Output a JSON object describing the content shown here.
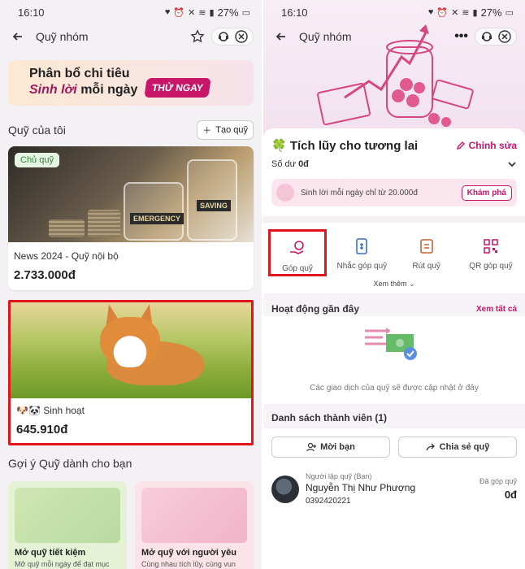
{
  "left": {
    "status": {
      "time": "16:10",
      "battery": "27%"
    },
    "header": {
      "title": "Quỹ nhóm"
    },
    "banner": {
      "line1": "Phân bổ chi tiêu",
      "line2_italic": "Sinh lời",
      "line2_rest": " mỗi ngày",
      "cta": "THỬ NGAY"
    },
    "my_funds": {
      "title": "Quỹ của tôi",
      "create_label": "Tạo quỹ"
    },
    "fund1": {
      "badge": "Chủ quỹ",
      "jar1": "EMERGENCY",
      "jar2": "SAVING",
      "name": "News 2024 - Quỹ nội bộ",
      "amount": "2.733.000đ"
    },
    "fund2": {
      "name": "🐶🐼 Sinh hoạt",
      "amount": "645.910đ"
    },
    "suggest": {
      "title": "Gợi ý Quỹ dành cho bạn",
      "items": [
        {
          "title": "Mở quỹ tiết kiệm",
          "desc": "Mở quỹ mỗi ngày để đạt mục tiêu tiết kiệm và sinh lời."
        },
        {
          "title": "Mở quỹ với người yêu",
          "desc": "Cùng nhau tích lũy, cùng vun đắp cho tương lai."
        }
      ]
    }
  },
  "right": {
    "status": {
      "time": "16:10",
      "battery": "27%"
    },
    "header": {
      "title": "Quỹ nhóm"
    },
    "fund": {
      "title": "🍀 Tích lũy cho tương lai",
      "edit": "Chỉnh sửa",
      "balance_label": "Số dư",
      "balance_value": "0đ"
    },
    "promo": {
      "text": "Sinh lời mỗi ngày chỉ từ 20.000đ",
      "button": "Khám phá"
    },
    "actions": [
      {
        "label": "Góp quỹ"
      },
      {
        "label": "Nhắc góp quỹ"
      },
      {
        "label": "Rút quỹ"
      },
      {
        "label": "QR góp quỹ"
      }
    ],
    "see_more": "Xem thêm",
    "recent": {
      "title": "Hoạt động gần đây",
      "see_all": "Xem tất cả",
      "empty": "Các giao dịch của quỹ sẽ được cập nhật ở đây"
    },
    "members": {
      "title": "Danh sách thành viên (1)",
      "invite": "Mời bạn",
      "share": "Chia sẻ quỹ",
      "list": [
        {
          "role": "Người lập quỹ (Bạn)",
          "name": "Nguyễn Thị Như Phượng",
          "phone": "0392420221",
          "contrib_label": "Đã góp quỹ",
          "contrib_value": "0đ"
        }
      ]
    }
  },
  "colors": {
    "accent": "#c8176a",
    "highlight": "#e4141b"
  }
}
